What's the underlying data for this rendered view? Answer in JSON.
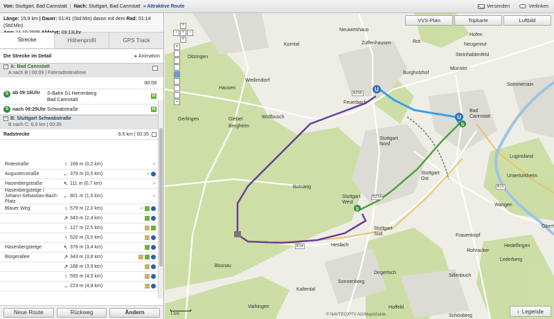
{
  "topbar": {
    "von_label": "Von:",
    "von_value": "Stuttgart, Bad Cannstatt",
    "nach_label": "Nach:",
    "nach_value": "Stuttgart, Bad Cannstatt",
    "sep": "|",
    "attr_label": "» Attraktive Route",
    "send_label": "Versenden",
    "link_label": "Verlinken"
  },
  "summary": {
    "line1_a": "Länge:",
    "laenge": "15,9 km",
    "dauer_label": "| Dauer:",
    "dauer": "01:41",
    "dauer_note": "(Std:Min) davon mit dem",
    "rad_label": "Rad:",
    "rad": "01:14",
    "rad_note": "(Std:Min)",
    "line2_a": "Ann:",
    "datum": "11.10.2009",
    "abfahrt_label": "Abfahrt:",
    "abfahrt": "09:13Uhr"
  },
  "tabs": [
    "Strecke",
    "Höhenprofil",
    "GPS Track"
  ],
  "detail": {
    "title": "Die Strecke im Detail",
    "animation": "▸ Animation"
  },
  "sectionA": {
    "title": "A: Bad Cannstatt",
    "sub": "A nach B | 00:09 | Fahrradmitnahme",
    "time": "00:09"
  },
  "train": {
    "ab_label": "ab 09:16Uhr",
    "line": "S-Bahn S1 Herrenberg",
    "from": "Bad Cannstatt",
    "nach_label": "nach 09:25Uhr",
    "to": "Schwabstraße",
    "badge": "S",
    "hbadge": "H"
  },
  "sectionB": {
    "title": "B: Stuttgart Schwabstraße",
    "sub": "B nach C: 6,6 km | 00:35"
  },
  "radstrecke": {
    "title": "Radstrecke",
    "summary": "6,6 km | 00:35"
  },
  "turns": [
    {
      "street": "Rotestraße",
      "arrow": "↑",
      "dist": "169 m (0,2 km)",
      "icons": [
        "w"
      ]
    },
    {
      "street": "Augustenstraße",
      "arrow": "←",
      "dist": "379 m (0,5 km)",
      "icons": [
        "w",
        "b"
      ]
    },
    {
      "street": "Hasenbergstraße",
      "arrow": "↖",
      "dist": "111 m (0,7 km)",
      "icons": [
        "w"
      ]
    },
    {
      "street": "Hasenbergsteige / Johann-Sebastian-Bach-Platz",
      "arrow": "←",
      "dist": "801 m (1,5 km)",
      "icons": [
        "w"
      ]
    },
    {
      "street": "Blauer Weg",
      "arrow": "↑",
      "dist": "579 m (2,0 km)",
      "icons": [
        "w",
        "g",
        "b"
      ]
    },
    {
      "street": "",
      "arrow": "↗",
      "dist": "343 m (2,4 km)",
      "icons": [
        "g",
        "b"
      ]
    },
    {
      "street": "",
      "arrow": "↑",
      "dist": "127 m (2,5 km)",
      "icons": [
        "y",
        "g"
      ]
    },
    {
      "street": "",
      "arrow": "↑",
      "dist": "520 m (3,0 km)",
      "icons": [
        "y",
        "b"
      ]
    },
    {
      "street": "Hasenbergsteige",
      "arrow": "↖",
      "dist": "378 m (3,4 km)",
      "icons": [
        "g",
        "b"
      ]
    },
    {
      "street": "Bürgerallee",
      "arrow": "↗",
      "dist": "343 m (3,8 km)",
      "icons": [
        "y",
        "g",
        "b"
      ]
    },
    {
      "street": "",
      "arrow": "↗",
      "dist": "188 m (3,9 km)",
      "icons": [
        "y",
        "b"
      ]
    },
    {
      "street": "",
      "arrow": "↑",
      "dist": "593 m (4,5 km)",
      "icons": [
        "y",
        "b"
      ]
    },
    {
      "street": "",
      "arrow": "→",
      "dist": "223 m (4,8 km)",
      "icons": [
        "y",
        "b"
      ]
    }
  ],
  "buttons": {
    "neue": "Neue Route",
    "rueck": "Rückweg",
    "aendern": "Ändern"
  },
  "map": {
    "tabs": [
      "VVS-Plan",
      "Topkarte",
      "Luftbild"
    ],
    "legend": "Legende",
    "scale": "1 km",
    "copyright": "© NAVTEQ/PTV AG/MapsGuide",
    "labels": {
      "ditzingen": "Ditzingen",
      "korntal": "Korntal",
      "neuwirtshaus": "Neuwirtshaus",
      "zuffenhausen": "Zuffenhausen",
      "rot": "Rot",
      "hofen": "Hofen",
      "neugereut": "Neugereut",
      "steinhaldenfeld": "Steinhaldenfeld",
      "hausen": "Hausen",
      "weilimdorf": "Weilimdorf",
      "burgholzhof": "Burgholzhof",
      "muenster": "Münster",
      "sommerrain": "Sommerrain",
      "feuerbach": "Feuerbach",
      "bad_cannstatt": "Bad\nCannstatt",
      "giebel": "Giebel",
      "bergheim": "Bergheim",
      "wolfbusch": "Wolfbusch",
      "gerlingen": "Gerlingen",
      "stuttgart_nord": "Stuttgart\nNord",
      "luginsland": "Luginsland",
      "untertuerkheim": "Untertürkheim",
      "stuttgart_ost": "Stuttgart\nOst",
      "botnang": "Botnang",
      "stuttgart_west": "Stuttgart\nWest",
      "wangen": "Wangen",
      "stuttgart_sued": "Stuttgart\nSüd",
      "frauenkopf": "Frauenkopf",
      "hedelfingen": "Hedelfingen",
      "heslach": "Heslach",
      "rohracker": "Rohracker",
      "buesnau": "Büsnau",
      "lederberg": "Lederberg",
      "degerloch": "Degerloch",
      "sonnenberg": "Sonnenberg",
      "sillenbuch": "Sillenbuch",
      "kaltental": "Kaltental",
      "vaihingen": "Vaihingen",
      "hoffeld": "Hoffeld",
      "schoenberg": "Schönberg",
      "b295": "B295",
      "b14": "B14",
      "b27a": "B27A",
      "b10": "B10",
      "obert": "Obert"
    }
  },
  "colors": {
    "route_purple": "#6b3d97",
    "route_blue": "#3aa0e8",
    "route_green": "#4aa23a"
  }
}
